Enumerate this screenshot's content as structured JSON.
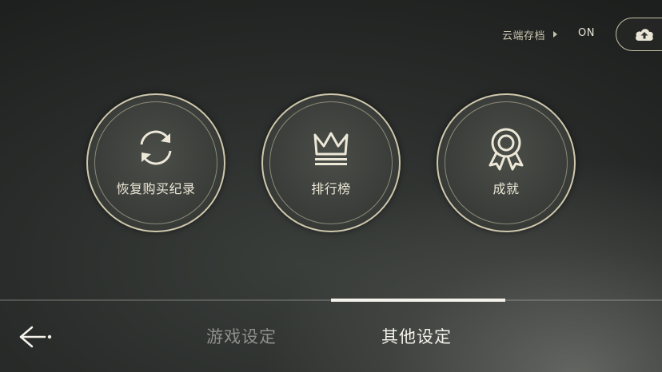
{
  "cloud_save": {
    "label": "云端存档",
    "status": "ON",
    "upload_icon": "cloud-upload-icon"
  },
  "menu": {
    "items": [
      {
        "label": "恢复购买纪录",
        "icon": "refresh-icon"
      },
      {
        "label": "排行榜",
        "icon": "crown-icon"
      },
      {
        "label": "成就",
        "icon": "medal-icon"
      }
    ]
  },
  "tabs": {
    "items": [
      {
        "label": "游戏设定",
        "active": false
      },
      {
        "label": "其他设定",
        "active": true
      }
    ]
  },
  "back_icon": "back-arrow-icon",
  "colors": {
    "accent": "#cfc8ad",
    "text_active": "#f4f2ea",
    "text_inactive": "#8e908b"
  }
}
